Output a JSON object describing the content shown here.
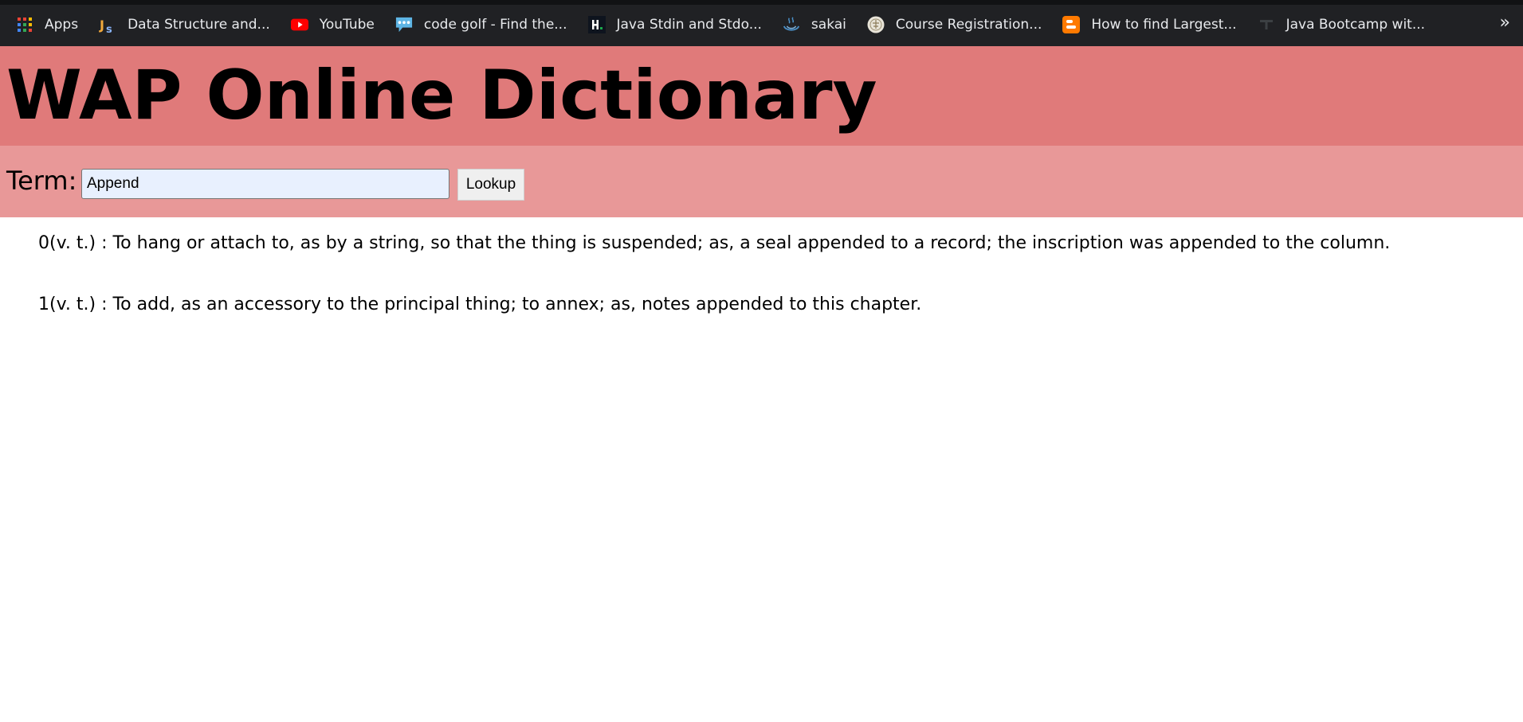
{
  "bookmarks": [
    {
      "label": "Apps",
      "icon": "apps-grid-icon"
    },
    {
      "label": "Data Structure and...",
      "icon": "js-logo-icon"
    },
    {
      "label": "YouTube",
      "icon": "youtube-icon"
    },
    {
      "label": "code golf - Find the...",
      "icon": "code-golf-speech-bubble-icon"
    },
    {
      "label": "Java Stdin and Stdo...",
      "icon": "hackerrank-icon"
    },
    {
      "label": "sakai",
      "icon": "sakai-icon"
    },
    {
      "label": "Course Registration...",
      "icon": "university-seal-icon"
    },
    {
      "label": "How to find Largest...",
      "icon": "blogger-icon"
    },
    {
      "label": "Java Bootcamp wit...",
      "icon": "bootcamp-icon"
    }
  ],
  "overflow_label": "»",
  "header": {
    "title": "WAP Online Dictionary"
  },
  "search": {
    "label": "Term:",
    "value": "Append",
    "button_label": "Lookup"
  },
  "results": [
    "0(v. t.) : To hang or attach to, as by a string, so that the thing is suspended; as, a seal appended to a record; the inscription was appended to the column.",
    "1(v. t.) : To add, as an accessory to the principal thing; to annex; as, notes appended to this chapter."
  ],
  "colors": {
    "bookmarks_bar": "#202124",
    "header_bg": "#e07a7a",
    "search_bg": "#e89898",
    "input_bg": "#e8f0fe"
  }
}
